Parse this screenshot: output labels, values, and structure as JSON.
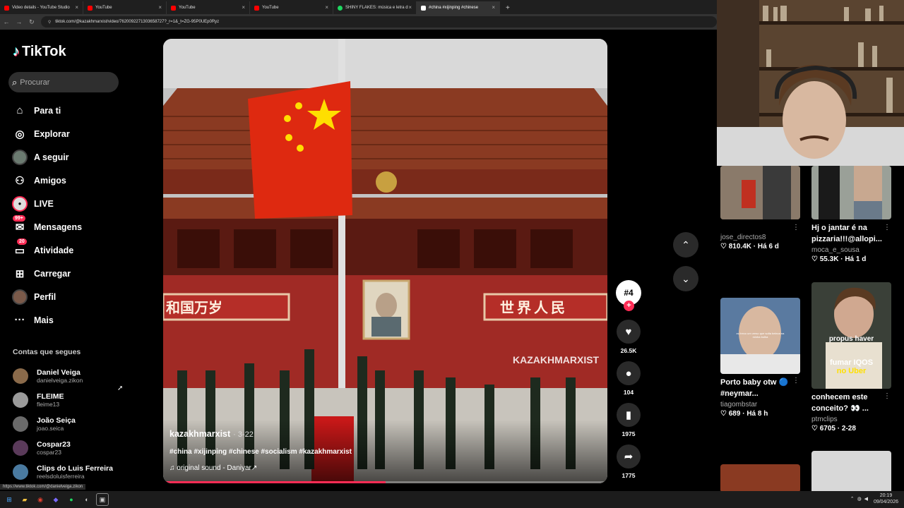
{
  "browser": {
    "tabs": [
      {
        "title": "Video details - YouTube Studio",
        "color": "#ff0000"
      },
      {
        "title": "YouTube",
        "color": "#ff0000"
      },
      {
        "title": "YouTube",
        "color": "#ff0000"
      },
      {
        "title": "YouTube",
        "color": "#ff0000"
      },
      {
        "title": "SHINY FLAKES: música e letra d",
        "color": "#1ed760"
      },
      {
        "title": "#china #xijinping #chinese",
        "color": "#ffffff",
        "active": true
      }
    ],
    "new_tab": "+",
    "url": "tiktok.com/@kazakhmarxist/video/7620092271303658727?_r=1&_t=ZG-95P0UEp0Ryz"
  },
  "sidebar": {
    "logo": "TikTok",
    "search_placeholder": "Procurar",
    "menu": [
      {
        "label": "Para ti",
        "icon": "home-icon"
      },
      {
        "label": "Explorar",
        "icon": "compass-icon"
      },
      {
        "label": "A seguir",
        "icon": "avatar-icon"
      },
      {
        "label": "Amigos",
        "icon": "friends-icon"
      },
      {
        "label": "LIVE",
        "icon": "live-icon"
      },
      {
        "label": "Mensagens",
        "icon": "message-icon",
        "badge": "99+"
      },
      {
        "label": "Atividade",
        "icon": "activity-icon",
        "badge": "20"
      },
      {
        "label": "Carregar",
        "icon": "upload-icon"
      },
      {
        "label": "Perfil",
        "icon": "profile-icon"
      },
      {
        "label": "Mais",
        "icon": "more-icon"
      }
    ],
    "following_header": "Contas que segues",
    "following": [
      {
        "name": "Daniel Veiga",
        "handle": "danielveiga.zikon"
      },
      {
        "name": "FLEIME",
        "handle": "fleime13"
      },
      {
        "name": "João Seiça",
        "handle": "joao.seica"
      },
      {
        "name": "Cospar23",
        "handle": "cospar23"
      },
      {
        "name": "Clips do Luis Ferreira",
        "handle": "reelsdoluisferreira"
      }
    ]
  },
  "video": {
    "author": "kazakhmarxist",
    "date": "· 3-22",
    "tags": "#china #xijinping #chinese #socialism #kazakhmarxist",
    "sound": "original sound - Daniyar",
    "watermark": "KAZAKHMARXIST",
    "banner_left": "和国万岁",
    "banner_right": "世界人民",
    "progress": 0.5
  },
  "actions": {
    "avatar_label": "#4",
    "likes": "26.5K",
    "comments": "104",
    "saves": "1975",
    "shares": "1775"
  },
  "grid": [
    {
      "title": "",
      "user": "jose_directos8",
      "stats": "♡ 810.4K · Há 6 d"
    },
    {
      "title": "Hj o jantar é na pizzaria!!!@allopi...",
      "user": "moca_e_sousa",
      "stats": "♡ 55.3K · Há 1 d"
    },
    {
      "title": "Porto baby otw 🔵 #neymar...",
      "user": "tiagombstar",
      "stats": "♡ 689 · Há 8 h",
      "overlay": "eu treco um verso que solta beleza na minha bolha"
    },
    {
      "title": "conhecem este conceito? 👀 ...",
      "user": "ptmclips",
      "stats": "♡ 6705 · 2-28",
      "overlay_1": "propus haver",
      "overlay_2": "fumar IQOS",
      "overlay_3": "no Uber"
    }
  ],
  "statusbar_link": "https://www.tiktok.com/@danielveiga.zikon",
  "taskbar": {
    "time": "20:19",
    "date": "09/04/2026"
  }
}
